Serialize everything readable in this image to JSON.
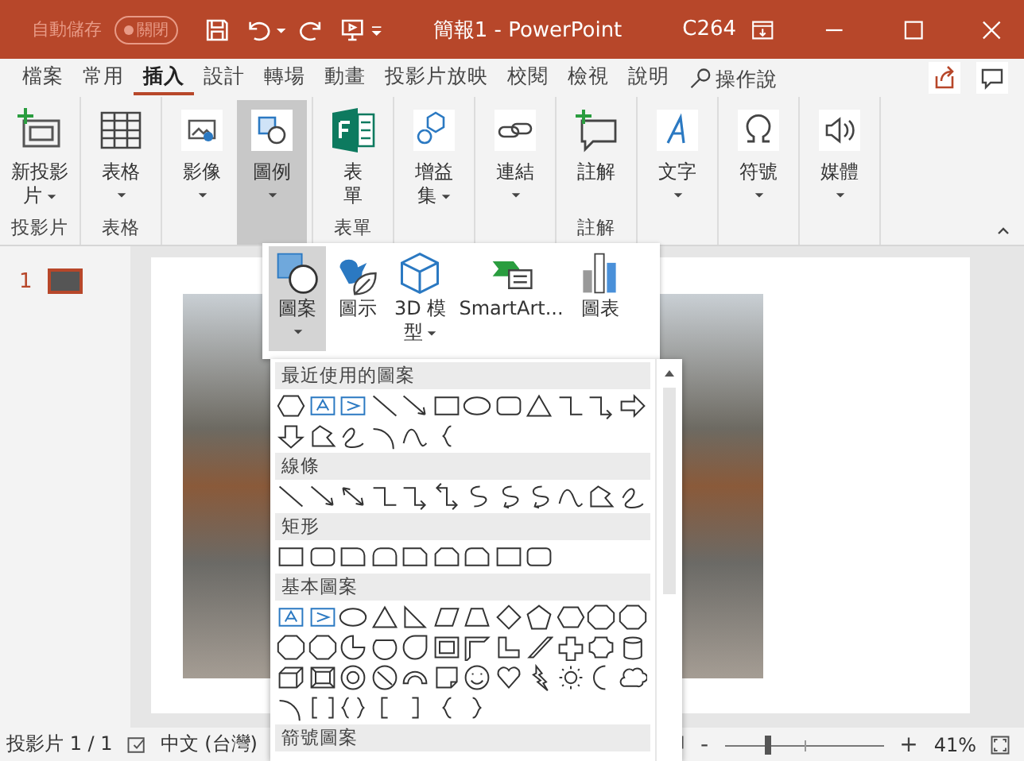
{
  "title_bar": {
    "autosave_label": "自動儲存",
    "autosave_toggle": {
      "label": "關閉",
      "on": false
    },
    "title": "簡報1 - PowerPoint",
    "user": "C264"
  },
  "tabs": [
    {
      "label": "檔案",
      "selected": false
    },
    {
      "label": "常用",
      "selected": false
    },
    {
      "label": "插入",
      "selected": true
    },
    {
      "label": "設計",
      "selected": false
    },
    {
      "label": "轉場",
      "selected": false
    },
    {
      "label": "動畫",
      "selected": false
    },
    {
      "label": "投影片放映",
      "selected": false
    },
    {
      "label": "校閱",
      "selected": false
    },
    {
      "label": "檢視",
      "selected": false
    },
    {
      "label": "說明",
      "selected": false
    }
  ],
  "search": {
    "placeholder": "操作說"
  },
  "ribbon": {
    "groups": [
      {
        "label": "投影片",
        "buttons": [
          {
            "kind": "new-slide",
            "lines": [
              "新投影",
              "片"
            ],
            "dropdown": true,
            "pressed": false
          }
        ]
      },
      {
        "label": "表格",
        "buttons": [
          {
            "kind": "table",
            "lines": [
              "表格"
            ],
            "dropdown": true,
            "pressed": false
          }
        ]
      },
      {
        "buttons": [
          {
            "kind": "image",
            "lines": [
              "影像"
            ],
            "dropdown": true,
            "pressed": false
          },
          {
            "kind": "illustration",
            "lines": [
              "圖例"
            ],
            "dropdown": true,
            "pressed": true
          }
        ]
      },
      {
        "label": "表單",
        "buttons": [
          {
            "kind": "forms",
            "lines": [
              "表",
              "單"
            ],
            "dropdown": false,
            "pressed": false
          }
        ]
      },
      {
        "buttons": [
          {
            "kind": "addins",
            "lines": [
              "增益",
              "集"
            ],
            "dropdown": true,
            "pressed": false
          }
        ]
      },
      {
        "buttons": [
          {
            "kind": "link",
            "lines": [
              "連結"
            ],
            "dropdown": true,
            "pressed": false
          }
        ]
      },
      {
        "label": "註解",
        "buttons": [
          {
            "kind": "comment",
            "lines": [
              "註解"
            ],
            "dropdown": false,
            "pressed": false
          }
        ]
      },
      {
        "buttons": [
          {
            "kind": "text",
            "lines": [
              "文字"
            ],
            "dropdown": true,
            "pressed": false
          }
        ]
      },
      {
        "buttons": [
          {
            "kind": "symbol",
            "lines": [
              "符號"
            ],
            "dropdown": true,
            "pressed": false
          }
        ]
      },
      {
        "buttons": [
          {
            "kind": "media",
            "lines": [
              "媒體"
            ],
            "dropdown": true,
            "pressed": false
          }
        ]
      }
    ]
  },
  "slides": [
    {
      "number": "1",
      "selected": true
    }
  ],
  "illustrations_menu": {
    "buttons": [
      {
        "kind": "shapes",
        "lines": [
          "圖案"
        ],
        "dropdown": true,
        "selected": true
      },
      {
        "kind": "icons",
        "lines": [
          "圖示"
        ],
        "dropdown": false,
        "selected": false
      },
      {
        "kind": "model",
        "lines": [
          "3D 模",
          "型"
        ],
        "dropdown": true,
        "selected": false
      },
      {
        "kind": "smartart",
        "lines": [
          "SmartArt..."
        ],
        "dropdown": false,
        "selected": false
      },
      {
        "kind": "chart",
        "lines": [
          "圖表"
        ],
        "dropdown": false,
        "selected": false
      }
    ],
    "sections": [
      {
        "title": "最近使用的圖案",
        "kind": "recent"
      },
      {
        "title": "線條",
        "kind": "lines"
      },
      {
        "title": "矩形",
        "kind": "rectangles"
      },
      {
        "title": "基本圖案",
        "kind": "basic"
      },
      {
        "title": "箭號圖案",
        "kind": "arrows"
      }
    ]
  },
  "status_bar": {
    "slide_info": "投影片 1 / 1",
    "language": "中文 (台灣)",
    "zoom_out": "-",
    "zoom_in": "+",
    "zoom": {
      "level": 0.27
    },
    "zoom_label": "41%"
  }
}
